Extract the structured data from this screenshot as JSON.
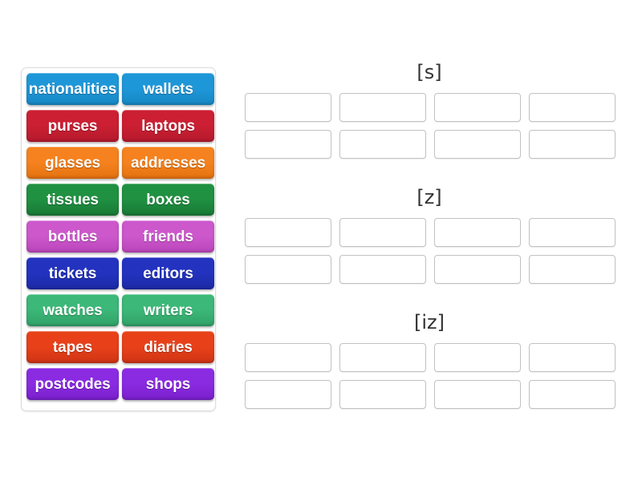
{
  "activity": {
    "type": "drag-and-drop-group-sort",
    "tile_text_color": "#ffffff"
  },
  "tile_panel": {
    "tiles": [
      {
        "label": "nationalities",
        "color": "#1e97d8",
        "color_dark": "#1787c4"
      },
      {
        "label": "wallets",
        "color": "#1e97d8",
        "color_dark": "#1787c4"
      },
      {
        "label": "purses",
        "color": "#cc1f33",
        "color_dark": "#b51a2c"
      },
      {
        "label": "laptops",
        "color": "#cc1f33",
        "color_dark": "#b51a2c"
      },
      {
        "label": "glasses",
        "color": "#f5821f",
        "color_dark": "#e3720f"
      },
      {
        "label": "addresses",
        "color": "#f5821f",
        "color_dark": "#e3720f"
      },
      {
        "label": "tissues",
        "color": "#1f9141",
        "color_dark": "#187936"
      },
      {
        "label": "boxes",
        "color": "#1f9141",
        "color_dark": "#187936"
      },
      {
        "label": "bottles",
        "color": "#cc58cc",
        "color_dark": "#bb45bb"
      },
      {
        "label": "friends",
        "color": "#cc58cc",
        "color_dark": "#bb45bb"
      },
      {
        "label": "tickets",
        "color": "#2333bf",
        "color_dark": "#1c2aa6"
      },
      {
        "label": "editors",
        "color": "#2333bf",
        "color_dark": "#1c2aa6"
      },
      {
        "label": "watches",
        "color": "#3cb878",
        "color_dark": "#31a167"
      },
      {
        "label": "writers",
        "color": "#3cb878",
        "color_dark": "#31a167"
      },
      {
        "label": "tapes",
        "color": "#e8411a",
        "color_dark": "#cf3413"
      },
      {
        "label": "diaries",
        "color": "#e8411a",
        "color_dark": "#cf3413"
      },
      {
        "label": "postcodes",
        "color": "#8a2be2",
        "color_dark": "#7a1fcc"
      },
      {
        "label": "shops",
        "color": "#8a2be2",
        "color_dark": "#7a1fcc"
      }
    ]
  },
  "zones": [
    {
      "id": "s",
      "title": "[s]",
      "slots": [
        "",
        "",
        "",
        "",
        "",
        "",
        "",
        ""
      ]
    },
    {
      "id": "z",
      "title": "[z]",
      "slots": [
        "",
        "",
        "",
        "",
        "",
        "",
        "",
        ""
      ]
    },
    {
      "id": "iz",
      "title": "[iz]",
      "slots": [
        "",
        "",
        "",
        "",
        "",
        "",
        "",
        ""
      ]
    }
  ]
}
